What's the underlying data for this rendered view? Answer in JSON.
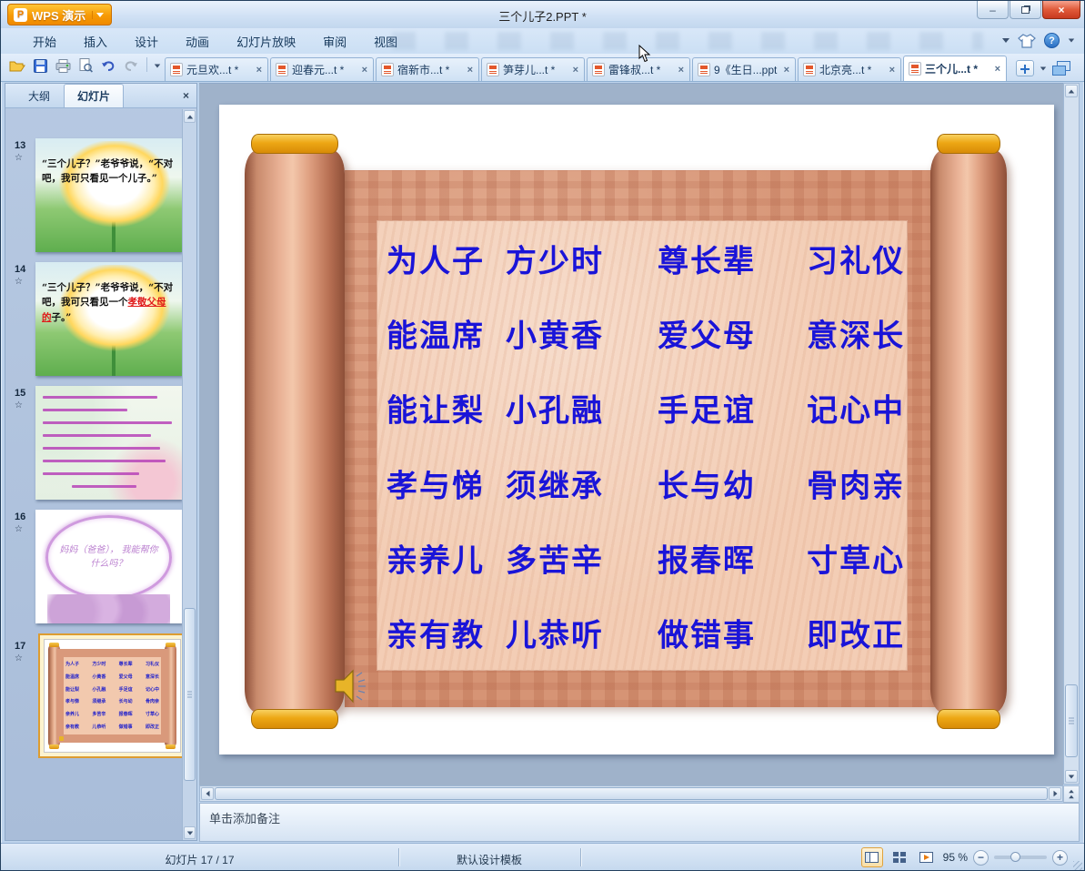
{
  "app": {
    "name": "WPS 演示",
    "title": "三个儿子2.PPT *"
  },
  "glyphs": {
    "close": "×",
    "minimize": "–",
    "question": "?",
    "star": "☆"
  },
  "menu": {
    "items": [
      "开始",
      "插入",
      "设计",
      "动画",
      "幻灯片放映",
      "审阅",
      "视图"
    ]
  },
  "quick_toolbar": {
    "icons": [
      "open-folder",
      "save",
      "print",
      "print-preview",
      "undo",
      "redo"
    ]
  },
  "doc_tabs": [
    {
      "label": "元旦欢...t *",
      "active": false
    },
    {
      "label": "迎春元...t *",
      "active": false
    },
    {
      "label": "宿新市...t *",
      "active": false
    },
    {
      "label": "笋芽儿...t *",
      "active": false
    },
    {
      "label": "雷锋叔...t *",
      "active": false
    },
    {
      "label": "9《生日...ppt *",
      "active": false
    },
    {
      "label": "北京亮...t *",
      "active": false
    },
    {
      "label": "三个儿...t *",
      "active": true
    }
  ],
  "sidebar": {
    "tabs": [
      {
        "label": "大纲"
      },
      {
        "label": "幻灯片",
        "active": true
      }
    ],
    "thumbnails": [
      {
        "number": "13",
        "text": "“三个儿子？”老爷爷说，“不对吧，我可只看见一个儿子。”"
      },
      {
        "number": "14",
        "text_before": "“三个儿子？”老爷爷说，“不对吧，我可只看见一个",
        "text_red": "孝敬父母的",
        "text_after": "子。”"
      },
      {
        "number": "15"
      },
      {
        "number": "16",
        "text": "妈妈（爸爸）， 我能帮你什么吗？"
      },
      {
        "number": "17",
        "selected": true
      }
    ]
  },
  "slide": {
    "text_color": "#1a14d8",
    "rows": [
      [
        "为人子",
        "方少时",
        "尊长辈",
        "习礼仪"
      ],
      [
        "能温席",
        "小黄香",
        "爱父母",
        "意深长"
      ],
      [
        "能让梨",
        "小孔融",
        "手足谊",
        "记心中"
      ],
      [
        "孝与悌",
        "须继承",
        "长与幼",
        "骨肉亲"
      ],
      [
        "亲养儿",
        "多苦辛",
        "报春晖",
        "寸草心"
      ],
      [
        "亲有教",
        "儿恭听",
        "做错事",
        "即改正"
      ]
    ]
  },
  "notes": {
    "placeholder": "单击添加备注"
  },
  "status": {
    "slide_counter": "幻灯片 17 / 17",
    "template": "默认设计模板",
    "zoom": "95 %"
  }
}
